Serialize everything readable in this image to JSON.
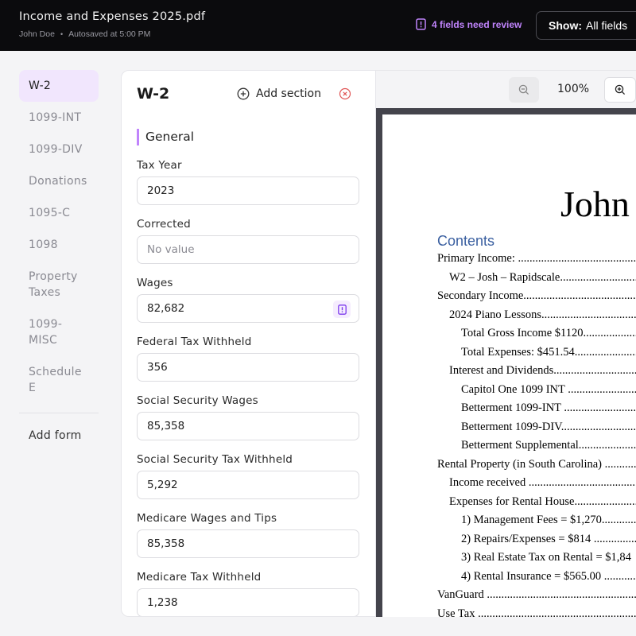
{
  "topbar": {
    "title": "Income and Expenses 2025.pdf",
    "user": "John Doe",
    "autosave": "Autosaved at 5:00 PM",
    "review_text": "4 fields need review",
    "show_label": "Show:",
    "show_value": "All fields"
  },
  "sidebar": {
    "items": [
      {
        "label": "W-2"
      },
      {
        "label": "1099-INT"
      },
      {
        "label": "1099-DIV"
      },
      {
        "label": "Donations"
      },
      {
        "label": "1095-C"
      },
      {
        "label": "1098"
      },
      {
        "label": "Property Taxes"
      },
      {
        "label": "1099-MISC"
      },
      {
        "label": "Schedule E"
      }
    ],
    "add_form": "Add form"
  },
  "form": {
    "title": "W-2",
    "add_section": "Add section",
    "section": "General",
    "fields": [
      {
        "label": "Tax Year",
        "value": "2023"
      },
      {
        "label": "Corrected",
        "placeholder": "No value"
      },
      {
        "label": "Wages",
        "value": "82,682"
      },
      {
        "label": "Federal Tax Withheld",
        "value": "356"
      },
      {
        "label": "Social Security Wages",
        "value": "85,358"
      },
      {
        "label": "Social Security Tax Withheld",
        "value": "5,292"
      },
      {
        "label": "Medicare Wages and Tips",
        "value": "85,358"
      },
      {
        "label": "Medicare Tax Withheld",
        "value": "1,238"
      }
    ]
  },
  "viewer": {
    "zoom": "100%",
    "page_heading": "John",
    "contents_title": "Contents",
    "toc": [
      "Primary Income: ...................................................",
      "W2 – Josh – Rapidscale.........................................",
      "Secondary Income.................................................",
      "2024 Piano Lessons.............................................",
      "Total Gross Income $1120.........................",
      "Total Expenses:  $451.54..........................",
      "Interest and Dividends.........................................",
      "Capitol One 1099 INT ...........................",
      "Betterment  1099-INT ...........................",
      "Betterment  1099-DIV............................",
      "Betterment  Supplemental......................",
      "Rental Property (in South Carolina) ...................",
      "Income received .................................................",
      "Expenses for Rental House..................................",
      "1) Management Fees = $1,270.................",
      "2) Repairs/Expenses = $814 .....................",
      "3) Real Estate Tax on Rental = $1,84",
      "4) Rental Insurance = $565.00 .................",
      "VanGuard .............................................................",
      "Use Tax ................................................................"
    ]
  },
  "colors": {
    "accent": "#c084fc",
    "topbar_bg": "#0b0b0d",
    "active_item_bg": "#f1e6fd"
  }
}
